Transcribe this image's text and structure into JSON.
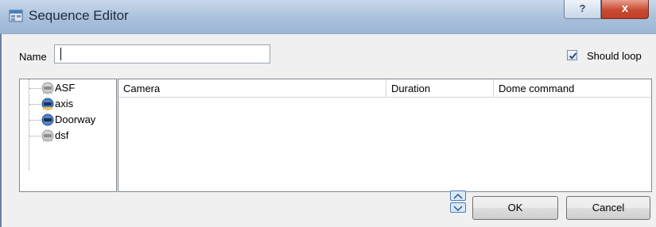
{
  "window": {
    "title": "Sequence Editor",
    "help_label": "?",
    "close_label": "x"
  },
  "form": {
    "name_label": "Name",
    "name_value": "",
    "should_loop_label": "Should loop",
    "should_loop_checked": true
  },
  "cameras": [
    {
      "label": "ASF",
      "icon": "camera-offline-icon"
    },
    {
      "label": "axis",
      "icon": "camera-selected-icon"
    },
    {
      "label": "Doorway",
      "icon": "camera-online-icon"
    },
    {
      "label": "dsf",
      "icon": "camera-offline-icon"
    }
  ],
  "table": {
    "columns": [
      "Camera",
      "Duration",
      "Dome command"
    ],
    "rows": []
  },
  "buttons": {
    "ok": "OK",
    "cancel": "Cancel"
  }
}
